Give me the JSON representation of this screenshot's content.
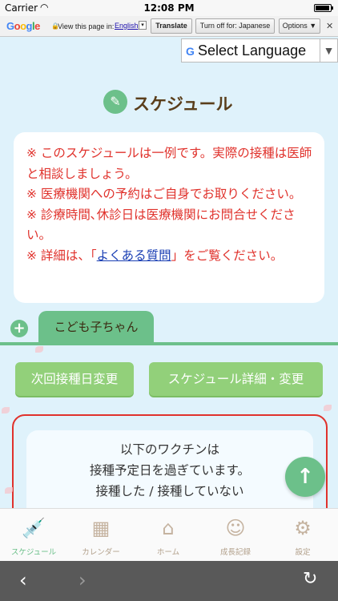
{
  "status_bar": {
    "carrier": "Carrier",
    "time": "12:08 PM"
  },
  "translate_bar": {
    "logo_letters": [
      "G",
      "o",
      "o",
      "g",
      "l",
      "e"
    ],
    "view_label": "View this page in:",
    "language": "English",
    "translate_label": "Translate",
    "turn_off_label": "Turn off for: Japanese",
    "options_label": "Options ▼",
    "close_label": "✕"
  },
  "language_select": {
    "value": "Select Language"
  },
  "page": {
    "title": "スケジュール",
    "notice_lines": [
      "※ このスケジュールは一例です。実際の接種は医師と相談しましょう。",
      "※ 医療機関への予約はご自身でお取りください。",
      "※ 診療時間､休診日は医療機関にお問合せください。"
    ],
    "notice_last_prefix": "※ 詳細は、「",
    "notice_link": "よくある質問",
    "notice_last_suffix": "」をご覧ください。",
    "child_tab": "こども子ちゃん",
    "next_date_button": "次回接種日変更",
    "schedule_detail_button": "スケジュール詳細・変更",
    "alert_lines": [
      "以下のワクチンは",
      "接種予定日を過ぎています。",
      "接種した / 接種していない"
    ]
  },
  "tabbar": {
    "items": [
      {
        "label": "スケジュール",
        "icon": "syringe-icon"
      },
      {
        "label": "カレンダー",
        "icon": "calendar-icon"
      },
      {
        "label": "ホーム",
        "icon": "home-icon"
      },
      {
        "label": "成長記録",
        "icon": "baby-face-icon"
      },
      {
        "label": "設定",
        "icon": "gear-icon"
      }
    ],
    "active_index": 0
  },
  "colors": {
    "accent_green": "#6cc08a",
    "button_green": "#92d07a",
    "warning_red": "#e0322c",
    "background": "#dff2fb",
    "title_brown": "#5a3e1b"
  }
}
